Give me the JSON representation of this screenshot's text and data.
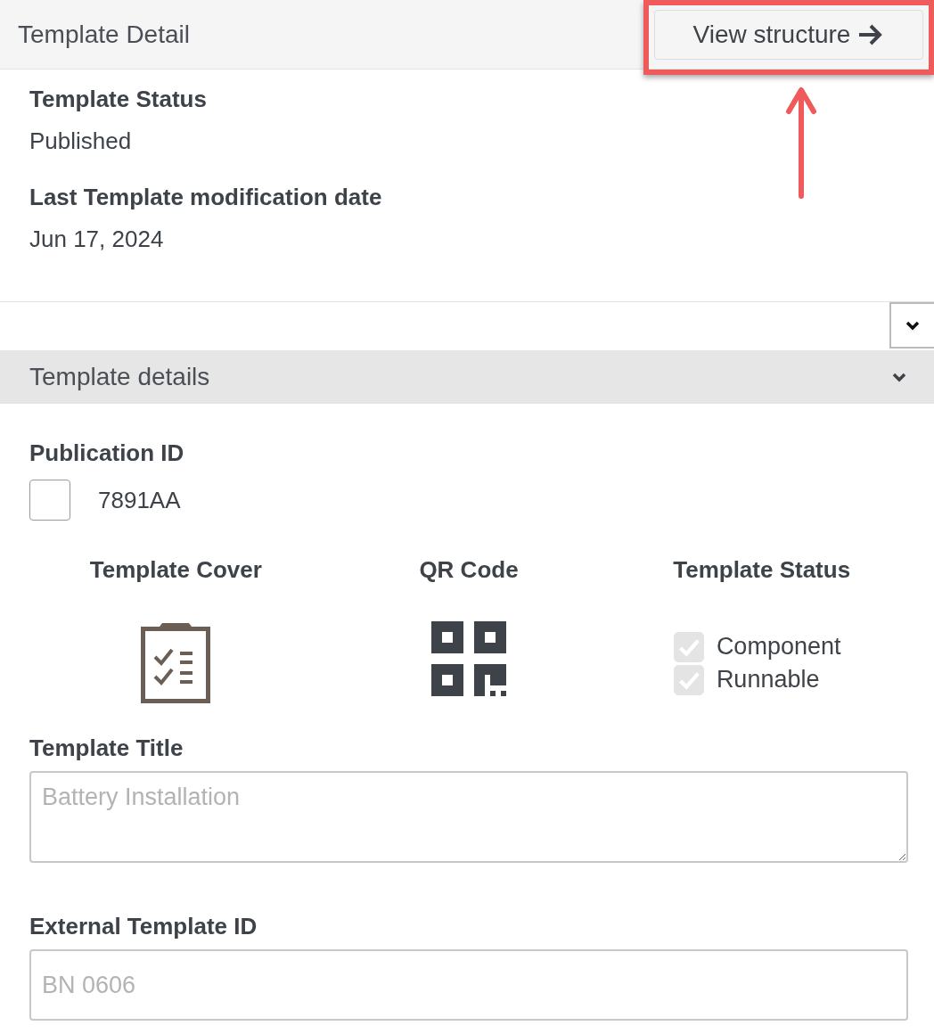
{
  "header": {
    "title": "Template Detail",
    "view_structure_button": {
      "label": "View structure",
      "highlighted": true
    }
  },
  "summary": [
    {
      "label": "Template Status",
      "value": "Published"
    },
    {
      "label": "Last Template modification date",
      "value": "Jun 17, 2024"
    }
  ],
  "details_section": {
    "title": "Template details",
    "expanded": true,
    "publication": {
      "label": "Publication ID",
      "checked": false,
      "value": "7891AA"
    },
    "columns": [
      {
        "kind": "cover",
        "heading": "Template Cover"
      },
      {
        "kind": "qr",
        "heading": "QR Code"
      },
      {
        "kind": "status",
        "heading": "Template Status",
        "options": [
          {
            "label": "Component",
            "checked": true,
            "disabled": true
          },
          {
            "label": "Runnable",
            "checked": true,
            "disabled": true
          }
        ]
      }
    ],
    "fields": [
      {
        "kind": "textarea",
        "label": "Template Title",
        "placeholder": "Battery Installation"
      },
      {
        "kind": "input",
        "label": "External Template ID",
        "placeholder": "BN 0606"
      }
    ]
  }
}
